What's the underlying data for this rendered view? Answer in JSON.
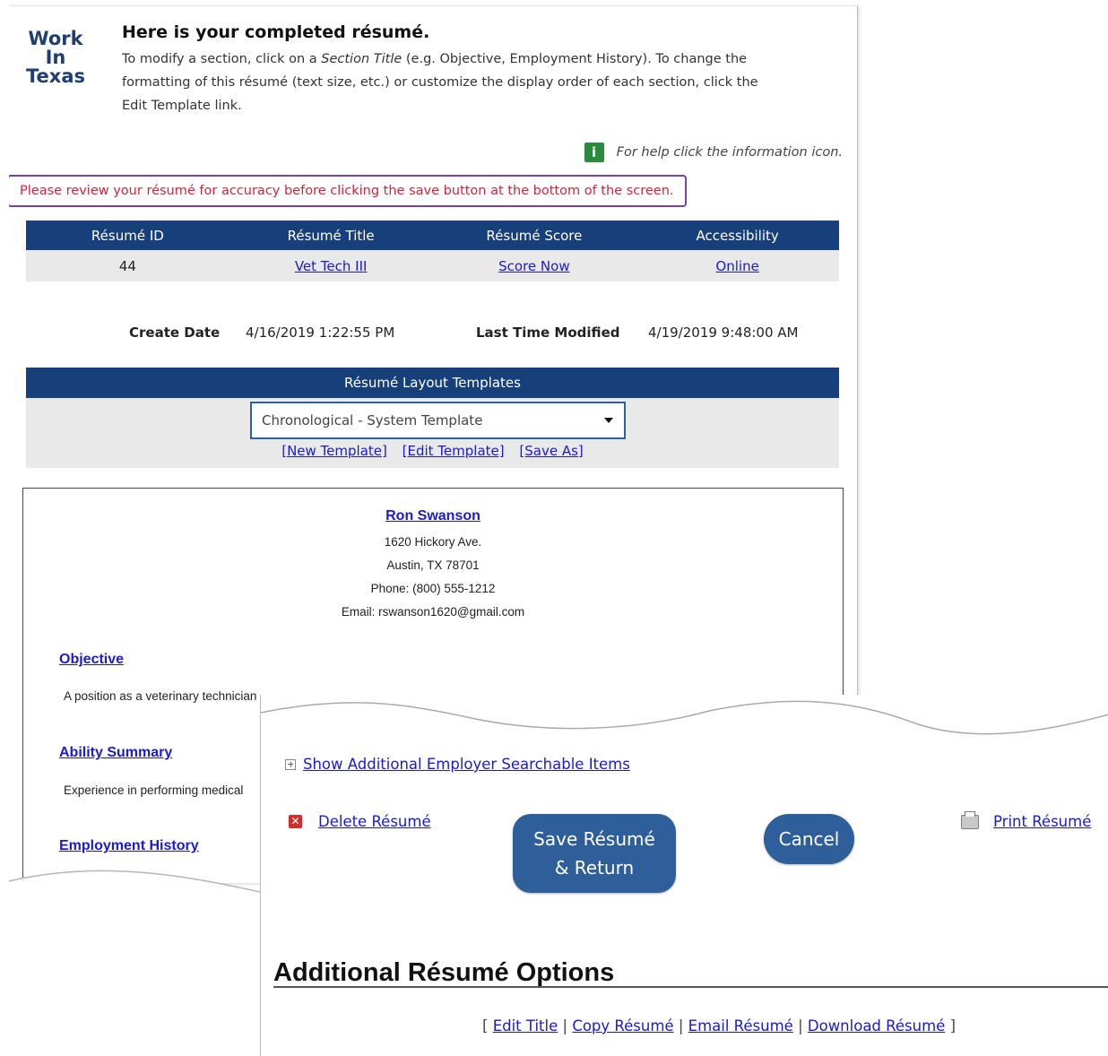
{
  "header": {
    "logo": [
      "Work",
      "In",
      "Texas"
    ],
    "title": "Here is your completed résumé.",
    "intro_part1": "To modify a section, click on a ",
    "intro_em": "Section Title",
    "intro_part2": " (e.g. Objective, Employment History). To change the formatting of this résumé (text size, etc.) or customize the display order of each section, click the Edit Template link.",
    "help_text": "For help click the information icon.",
    "warning": "Please review your résumé for accuracy before clicking the save button at the bottom of the screen."
  },
  "resume_table": {
    "headers": [
      "Résumé ID",
      "Résumé Title",
      "Résumé Score",
      "Accessibility"
    ],
    "id": "44",
    "title": "Vet Tech III",
    "score": "Score Now",
    "accessibility": "Online"
  },
  "dates": {
    "create_label": "Create Date",
    "create_value": "4/16/2019 1:22:55 PM",
    "modified_label": "Last Time Modified",
    "modified_value": "4/19/2019 9:48:00 AM"
  },
  "templates": {
    "header": "Résumé Layout Templates",
    "selected": "Chronological - System Template",
    "new": "[New Template]",
    "edit": "[Edit Template]",
    "save_as": "[Save As]"
  },
  "resume": {
    "name": "Ron Swanson",
    "address1": "1620 Hickory Ave.",
    "address2": "Austin, TX 78701",
    "phone": "Phone: (800) 555-1212",
    "email": "Email: rswanson1620@gmail.com",
    "objective_title": "Objective",
    "objective_text": "A position as a veterinary technician",
    "ability_title": "Ability Summary",
    "ability_text": "Experience in performing medical",
    "employment_title": "Employment History"
  },
  "bottom": {
    "show_additional": "Show Additional Employer Searchable Items",
    "delete": "Delete Résumé",
    "save_line1": "Save Résumé",
    "save_line2": "& Return",
    "cancel": "Cancel",
    "print": "Print Résumé",
    "additional_title": "Additional Résumé Options",
    "open_bracket": "[",
    "edit_title": "Edit Title",
    "copy": "Copy Résumé",
    "email": "Email Résumé",
    "download": "Download Résumé",
    "close_bracket": "]"
  }
}
